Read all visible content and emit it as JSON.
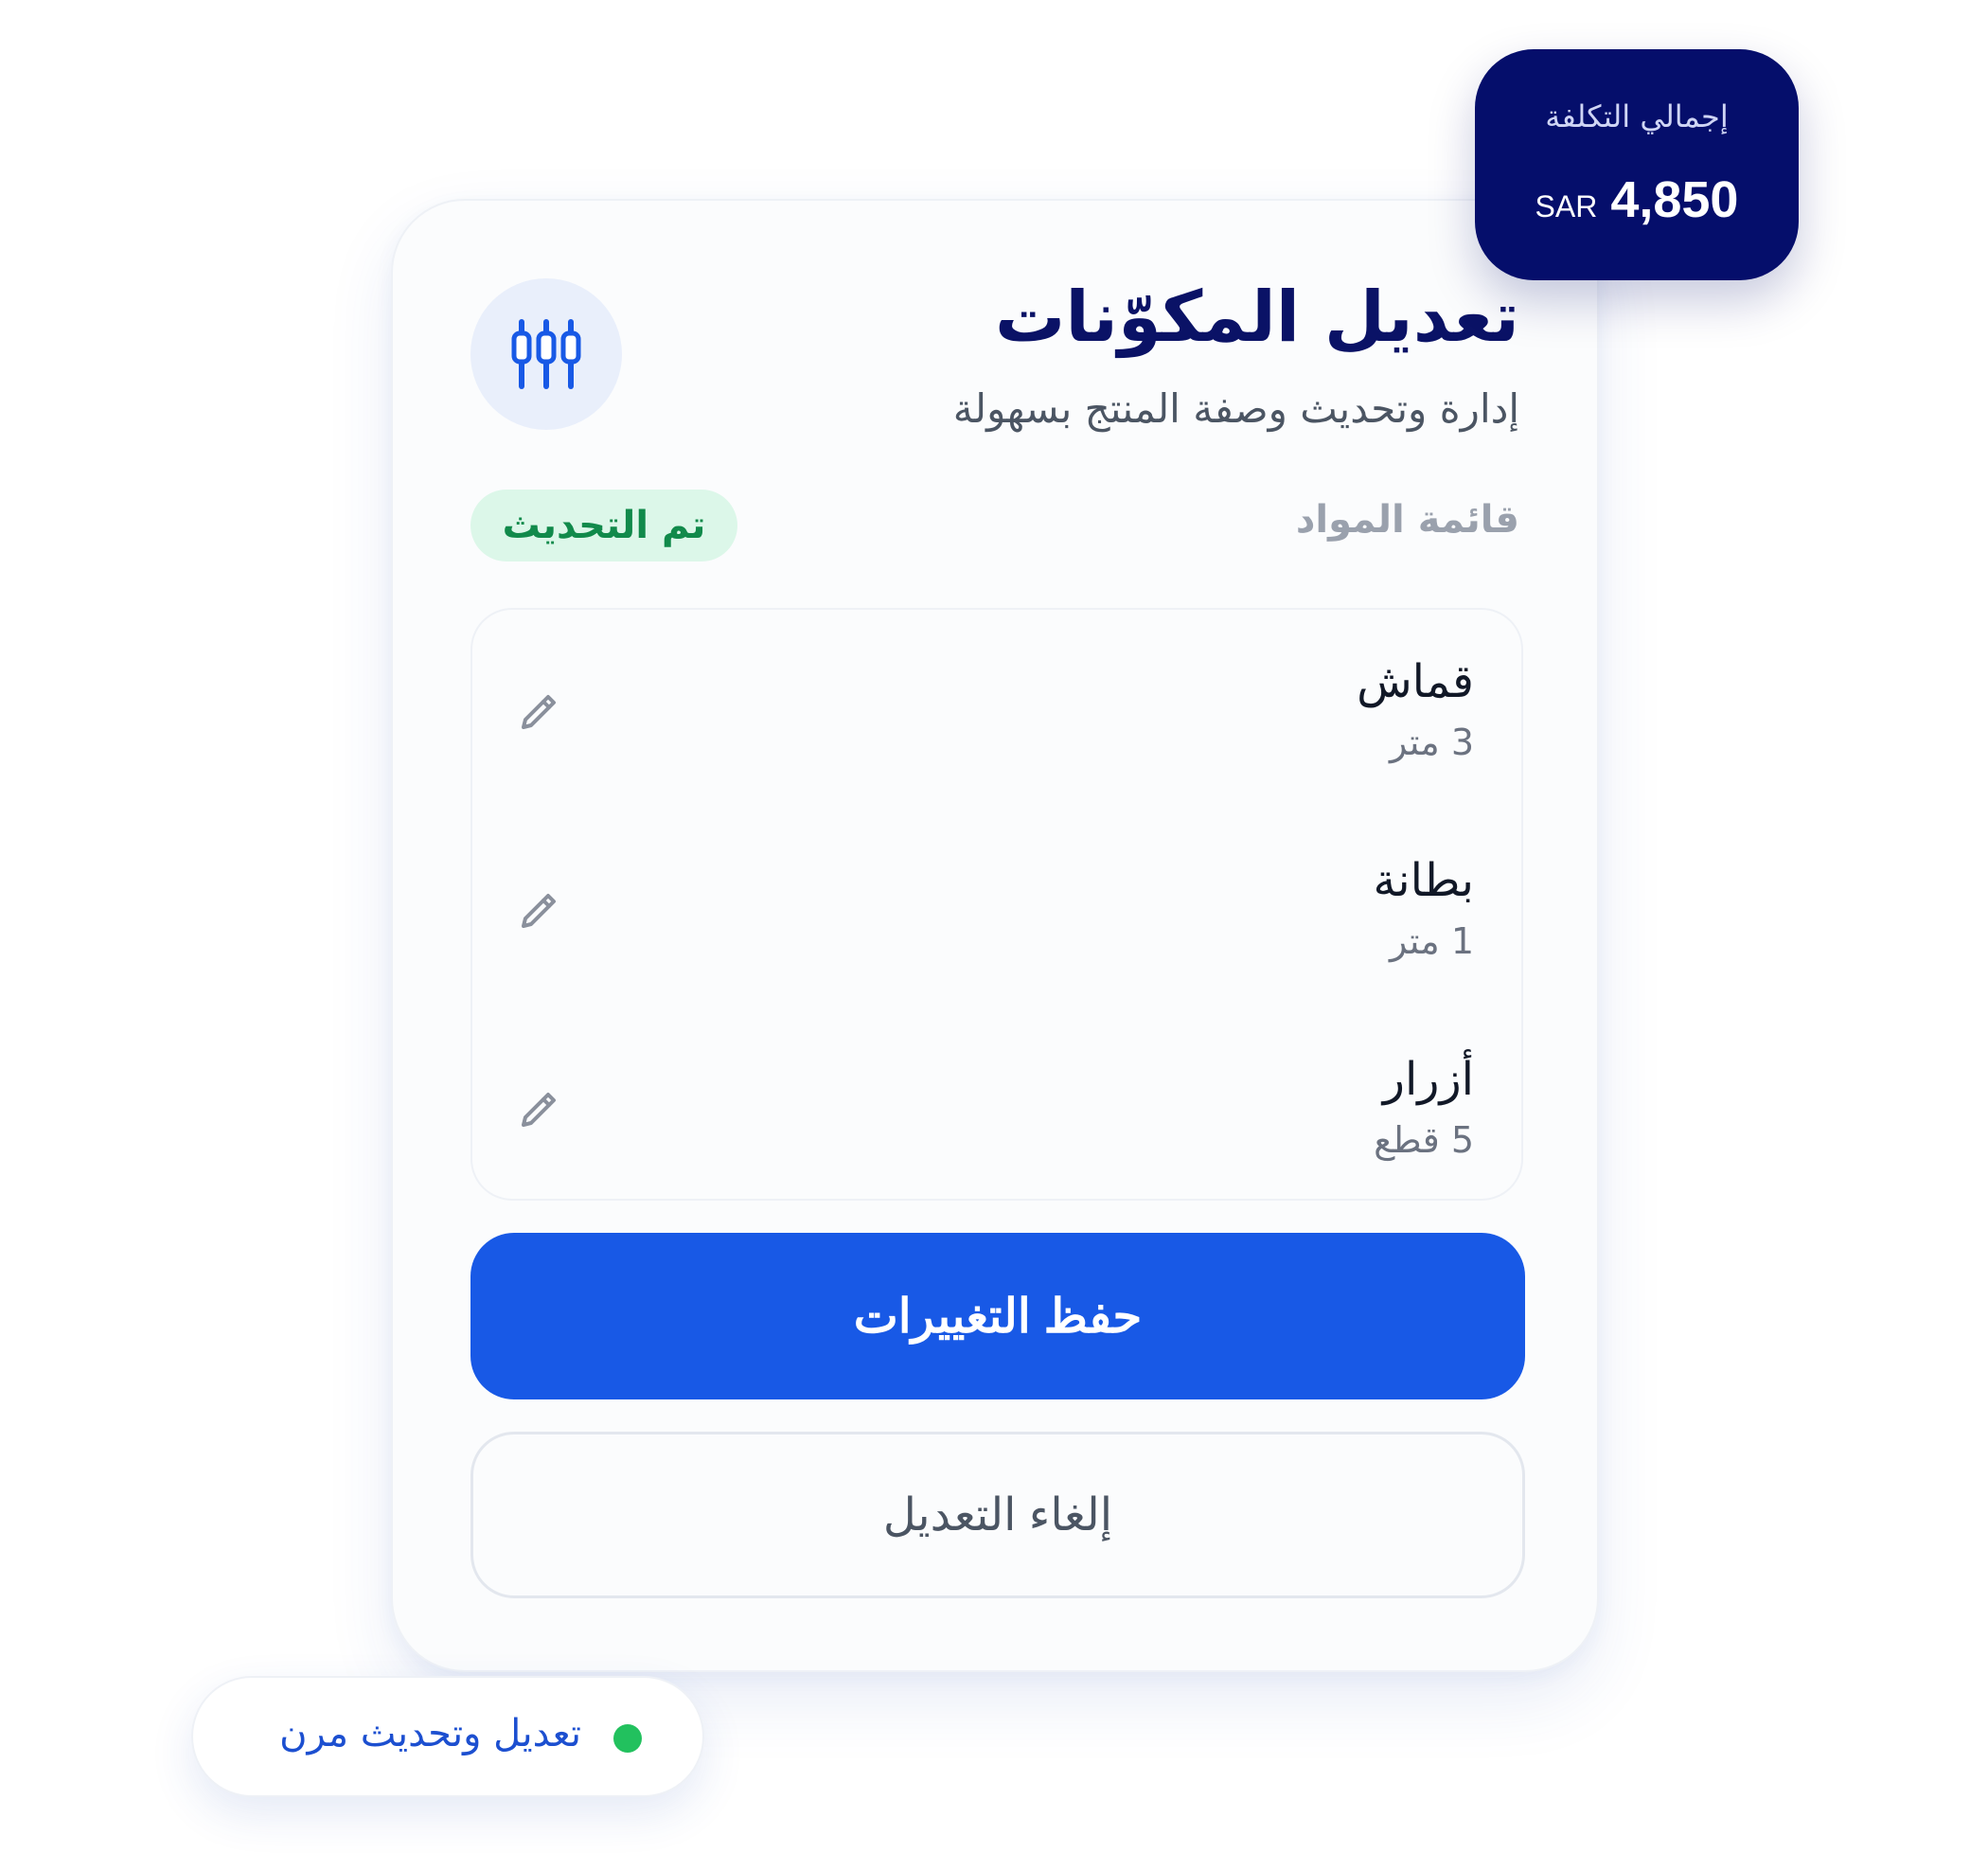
{
  "colors": {
    "primary": "#1859e6",
    "navy": "#050e6b",
    "success_bg": "#dcf7e9",
    "success_text": "#118a4b",
    "status_dot": "#22c15e"
  },
  "cost_badge": {
    "label": "إجمالي التكلفة",
    "currency": "SAR",
    "amount": "4,850"
  },
  "card": {
    "icon": "sliders-icon",
    "title": "تعديل المكوّنات",
    "subtitle": "إدارة وتحديث وصفة المنتج بسهولة",
    "list_heading": "قائمة المواد",
    "status_badge": "تم التحديث",
    "materials": [
      {
        "name": "قماش",
        "quantity": "3 متر",
        "edit_icon": "pencil-icon"
      },
      {
        "name": "بطانة",
        "quantity": "1 متر",
        "edit_icon": "pencil-icon"
      },
      {
        "name": "أزرار",
        "quantity": "5 قطع",
        "edit_icon": "pencil-icon"
      }
    ],
    "save_label": "حفظ التغييرات",
    "cancel_label": "إلغاء التعديل"
  },
  "flex_pill": {
    "label": "تعديل وتحديث مرن",
    "status": "online-dot"
  }
}
